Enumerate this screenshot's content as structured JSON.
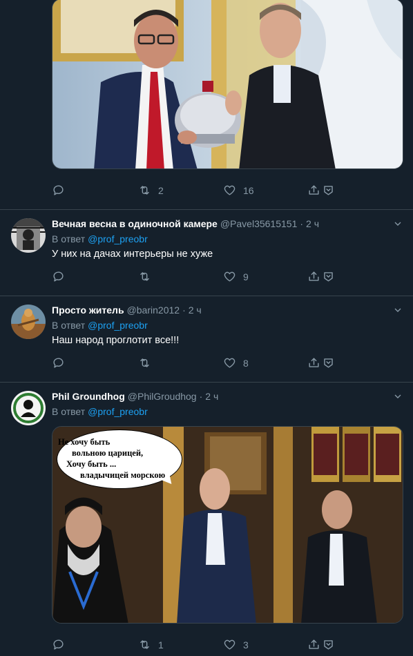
{
  "tweets": [
    {
      "actions": {
        "reply_count": "",
        "retweet_count": "2",
        "like_count": "16"
      }
    },
    {
      "name": "Вечная весна в одиночной камере",
      "handle": "@Pavel35615151",
      "time": "2 ч",
      "reply_prefix": "В ответ",
      "reply_to": "@prof_preobr",
      "text": "У них на дачах интерьеры не хуже",
      "actions": {
        "reply_count": "",
        "retweet_count": "",
        "like_count": "9"
      }
    },
    {
      "name": "Просто житель",
      "handle": "@barin2012",
      "time": "2 ч",
      "reply_prefix": "В ответ",
      "reply_to": "@prof_preobr",
      "text": "Наш народ проглотит все!!!",
      "actions": {
        "reply_count": "",
        "retweet_count": "",
        "like_count": "8"
      }
    },
    {
      "name": "Phil Groundhog",
      "handle": "@PhilGroudhog",
      "time": "2 ч",
      "reply_prefix": "В ответ",
      "reply_to": "@prof_preobr",
      "image_caption": {
        "line1": "Не хочу быть",
        "line2": "вольною царицей,",
        "line3": "Хочу быть ...",
        "line4": "владычицей морскою"
      },
      "actions": {
        "reply_count": "",
        "retweet_count": "1",
        "like_count": "3"
      }
    }
  ],
  "icons": {
    "reply": "reply-icon",
    "retweet": "retweet-icon",
    "like": "like-icon",
    "share": "share-icon",
    "more": "chevron-down-icon"
  },
  "colors": {
    "background": "#15202b",
    "divider": "#38444d",
    "secondary_text": "#8899a6",
    "link": "#1da1f2"
  }
}
